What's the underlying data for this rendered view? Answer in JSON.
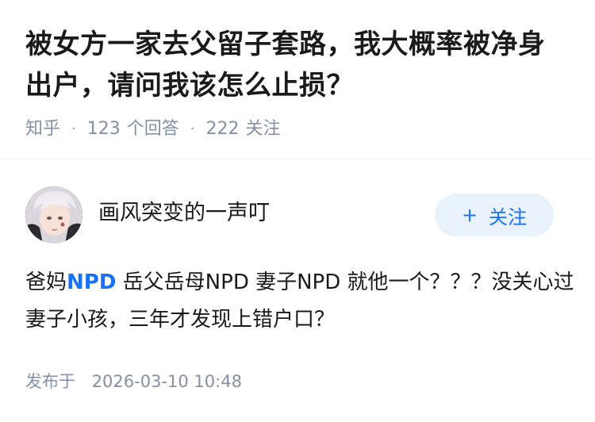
{
  "question": {
    "title": "被女方一家去父留子套路，我大概率被净身出户，请问我该怎么止损？",
    "meta": {
      "source": "知乎",
      "answer_count": "123",
      "answer_label": "个回答",
      "follower_count": "222",
      "follower_label": "关注"
    }
  },
  "answer": {
    "author": {
      "name": "画风突变的一声叮",
      "avatar_icon": "avatar-image"
    },
    "follow_button": {
      "icon": "plus-icon",
      "label": "关注"
    },
    "content": {
      "prefix": "爸妈",
      "link_text": "NPD",
      "rest": " 岳父岳母NPD 妻子NPD 就他一个？？？没关心过妻子小孩，三年才发现上错户口？"
    },
    "publish": {
      "label": "发布于",
      "datetime": "2026-03-10 10:48"
    }
  },
  "colors": {
    "accent": "#1772f6",
    "meta_text": "#8590a6",
    "button_bg": "#e9f1fb"
  }
}
